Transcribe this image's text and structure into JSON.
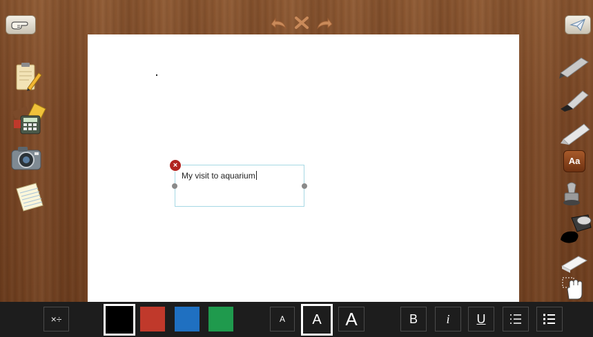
{
  "canvas": {
    "textbox": {
      "text": "My visit to aquarium",
      "delete_symbol": "×"
    }
  },
  "top_bar": {
    "left_button_icon": "pointing-hand-icon",
    "right_button_icon": "paper-plane-icon",
    "center_tools": [
      "undo-icon",
      "clear-icon",
      "redo-icon"
    ]
  },
  "left_tools": [
    "notepad-pencil-icon",
    "calculator-ruler-icon",
    "camera-icon",
    "lined-paper-icon"
  ],
  "right_tools": [
    "marker-icon",
    "brush-icon",
    "crayon-icon",
    "text-tool-icon",
    "stamp-icon",
    "paint-bucket-icon",
    "eraser-icon",
    "hand-select-icon"
  ],
  "right_text_tool_label": "Aa",
  "bottom_toolbar": {
    "math_label": "×÷",
    "colors": [
      {
        "name": "black",
        "hex": "#000000",
        "selected": true
      },
      {
        "name": "red",
        "hex": "#c0392b",
        "selected": false
      },
      {
        "name": "blue",
        "hex": "#1f70c1",
        "selected": false
      },
      {
        "name": "green",
        "hex": "#1f9a4d",
        "selected": false
      }
    ],
    "font_sizes": [
      {
        "label": "A",
        "size": "small",
        "selected": false
      },
      {
        "label": "A",
        "size": "medium",
        "selected": true
      },
      {
        "label": "A",
        "size": "large",
        "selected": false
      }
    ],
    "bold_label": "B",
    "italic_label": "i",
    "underline_label": "U"
  }
}
